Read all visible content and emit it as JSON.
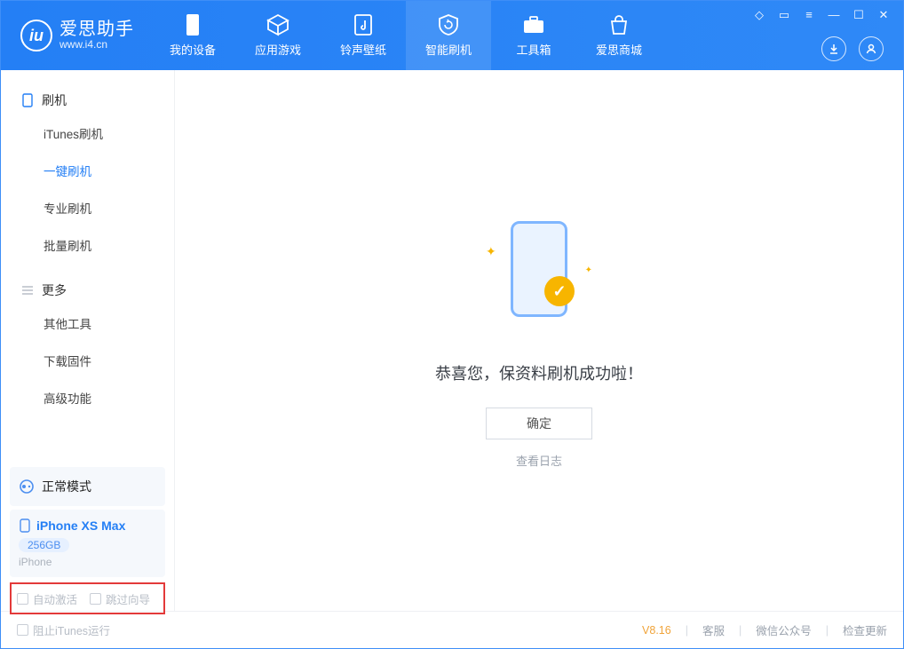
{
  "app": {
    "title": "爱思助手",
    "subtitle": "www.i4.cn"
  },
  "nav": {
    "device": "我的设备",
    "apps": "应用游戏",
    "ringtone": "铃声壁纸",
    "flash": "智能刷机",
    "toolbox": "工具箱",
    "store": "爱思商城"
  },
  "sidebar": {
    "section_flash": "刷机",
    "itunes": "iTunes刷机",
    "oneclick": "一键刷机",
    "pro": "专业刷机",
    "batch": "批量刷机",
    "section_more": "更多",
    "other": "其他工具",
    "firmware": "下载固件",
    "advanced": "高级功能"
  },
  "mode": {
    "label": "正常模式"
  },
  "device": {
    "name": "iPhone XS Max",
    "capacity": "256GB",
    "type": "iPhone"
  },
  "options": {
    "auto_activate": "自动激活",
    "skip_guide": "跳过向导"
  },
  "main": {
    "message": "恭喜您，保资料刷机成功啦！",
    "ok": "确定",
    "view_log": "查看日志"
  },
  "footer": {
    "block_itunes": "阻止iTunes运行",
    "version": "V8.16",
    "support": "客服",
    "wechat": "微信公众号",
    "update": "检查更新"
  }
}
